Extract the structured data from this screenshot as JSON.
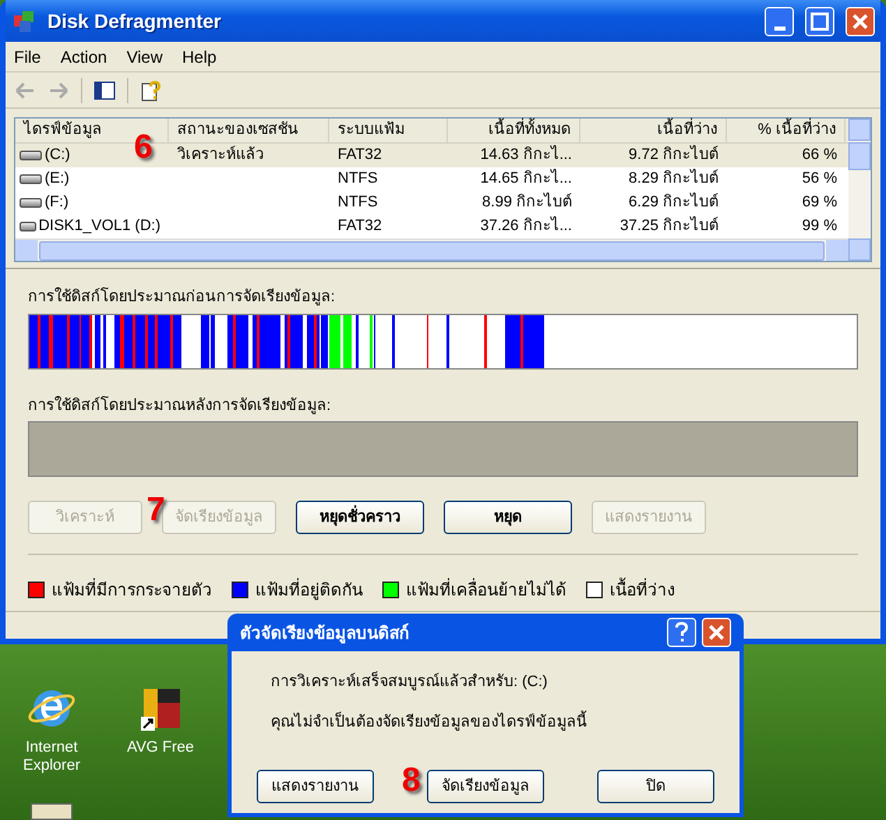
{
  "window": {
    "title": "Disk Defragmenter"
  },
  "menu": [
    "File",
    "Action",
    "View",
    "Help"
  ],
  "volumes": {
    "columns": [
      "ไดรฟ์ข้อมูล",
      "สถานะของเซสชัน",
      "ระบบแฟ้ม",
      "เนื้อที่ทั้งหมด",
      "เนื้อที่ว่าง",
      "% เนื้อที่ว่าง"
    ],
    "rows": [
      {
        "selected": true,
        "cells": [
          "(C:)",
          "วิเคราะห์แล้ว",
          "FAT32",
          "14.63 กิกะไ...",
          "9.72 กิกะไบต์",
          "66 %"
        ]
      },
      {
        "selected": false,
        "cells": [
          "(E:)",
          "",
          "NTFS",
          "14.65 กิกะไ...",
          "8.29 กิกะไบต์",
          "56 %"
        ]
      },
      {
        "selected": false,
        "cells": [
          "(F:)",
          "",
          "NTFS",
          "8.99 กิกะไบต์",
          "6.29 กิกะไบต์",
          "69 %"
        ]
      },
      {
        "selected": false,
        "cells": [
          "DISK1_VOL1 (D:)",
          "",
          "FAT32",
          "37.26 กิกะไ...",
          "37.25 กิกะไบต์",
          "99 %"
        ]
      }
    ]
  },
  "before_label": "การใช้ดิสก์โดยประมาณก่อนการจัดเรียงข้อมูล:",
  "after_label": "การใช้ดิสก์โดยประมาณหลังการจัดเรียงข้อมูล:",
  "buttons": [
    {
      "label": "วิเคราะห์",
      "disabled": true
    },
    {
      "label": "จัดเรียงข้อมูล",
      "disabled": true
    },
    {
      "label": "หยุดชั่วคราว",
      "disabled": false
    },
    {
      "label": "หยุด",
      "disabled": false
    },
    {
      "label": "แสดงรายงาน",
      "disabled": true
    }
  ],
  "legend": [
    {
      "label": "แฟ้มที่มีการกระจายตัว",
      "color": "#ff0000"
    },
    {
      "label": "แฟ้มที่อยู่ติดกัน",
      "color": "#0000ff"
    },
    {
      "label": "แฟ้มที่เคลื่อนย้ายไม่ได้",
      "color": "#00ff00"
    },
    {
      "label": "เนื้อที่ว่าง",
      "color": "#ffffff"
    }
  ],
  "dialog": {
    "title": "ตัวจัดเรียงข้อมูลบนดิสก์",
    "messages": [
      "การวิเคราะห์เสร็จสมบูรณ์แล้วสำหรับ: (C:)",
      "คุณไม่จำเป็นต้องจัดเรียงข้อมูลของไดรฟ์ข้อมูลนี้"
    ],
    "buttons": [
      "แสดงรายงาน",
      "จัดเรียงข้อมูล",
      "ปิด"
    ]
  },
  "desktop_icons": [
    {
      "label": "Internet Explorer",
      "kind": "browser"
    },
    {
      "label": "AVG Free",
      "kind": "antivirus"
    }
  ],
  "annotations": [
    "6",
    "7",
    "8"
  ]
}
